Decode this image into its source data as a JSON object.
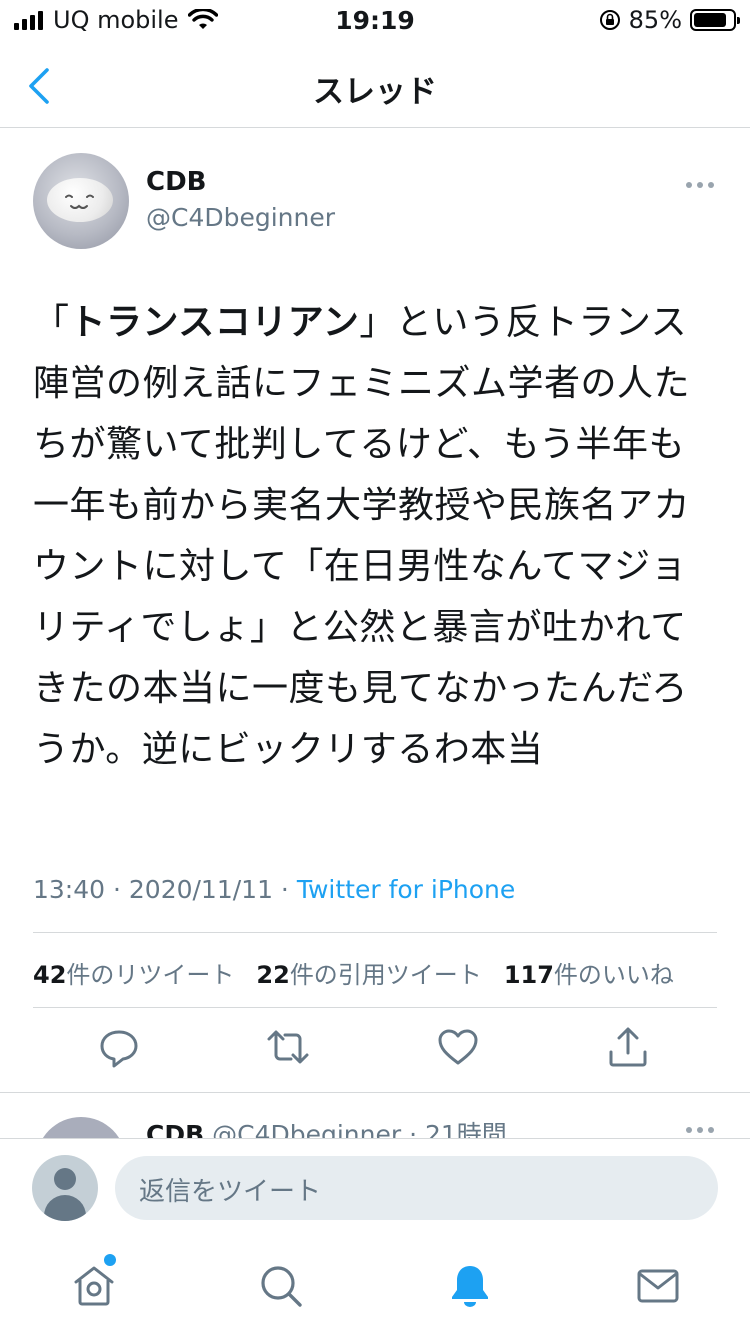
{
  "status_bar": {
    "carrier": "UQ mobile",
    "time": "19:19",
    "battery_percent": "85%",
    "battery_level": 0.85
  },
  "nav": {
    "title": "スレッド",
    "back_icon": "chevron-left-icon"
  },
  "tweet": {
    "author_name": "CDB",
    "author_handle": "@C4Dbeginner",
    "text_bold": "トランスコリアン",
    "text_open": "「",
    "text_rest": "」という反トランス陣営の例え話にフェミニズム学者の人たちが驚いて批判してるけど、もう半年も一年も前から実名大学教授や民族名アカウントに対して「在日男性なんてマジョリティでしょ」と公然と暴言が吐かれてきたの本当に一度も見てなかったんだろうか。逆にビックリするわ本当",
    "time": "13:40",
    "date": "2020/11/11",
    "separator": " · ",
    "source": "Twitter for iPhone",
    "stats": {
      "retweets_count": "42",
      "retweets_label": "件のリツイート",
      "quotes_count": "22",
      "quotes_label": "件の引用ツイート",
      "likes_count": "117",
      "likes_label": "件のいいね"
    },
    "actions": [
      "reply-icon",
      "retweet-icon",
      "like-icon",
      "share-icon"
    ]
  },
  "next_tweet": {
    "author_name": "CDB",
    "author_handle": "@C4Dbeginner",
    "age": "21時間",
    "separator": " · "
  },
  "reply_bar": {
    "placeholder": "返信をツイート"
  },
  "tab_bar": {
    "items": [
      "home-icon",
      "search-icon",
      "notifications-icon",
      "messages-icon"
    ],
    "active": "notifications-icon"
  },
  "colors": {
    "accent": "#1da1f2",
    "secondary_text": "#657786",
    "divider": "#d6d9db"
  }
}
